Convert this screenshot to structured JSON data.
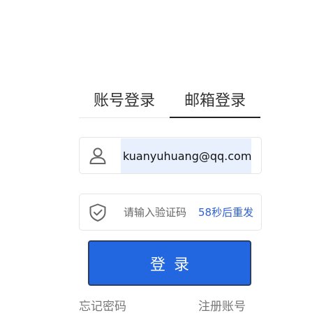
{
  "tabs": {
    "account_login": "账号登录",
    "email_login": "邮箱登录",
    "active": "email_login"
  },
  "email_field": {
    "value": "kuanyuhuang@qq.com",
    "icon": "user-icon"
  },
  "code_field": {
    "placeholder": "请输入验证码",
    "value": "",
    "icon": "shield-check-icon",
    "resend_label": "58秒后重发"
  },
  "login_button": {
    "label": "登录"
  },
  "links": {
    "forgot_password": "忘记密码",
    "register": "注册账号"
  },
  "colors": {
    "primary_button": "#2266e0",
    "resend_link": "#2f5fd0",
    "autofill_bg": "#e8f0fe"
  }
}
